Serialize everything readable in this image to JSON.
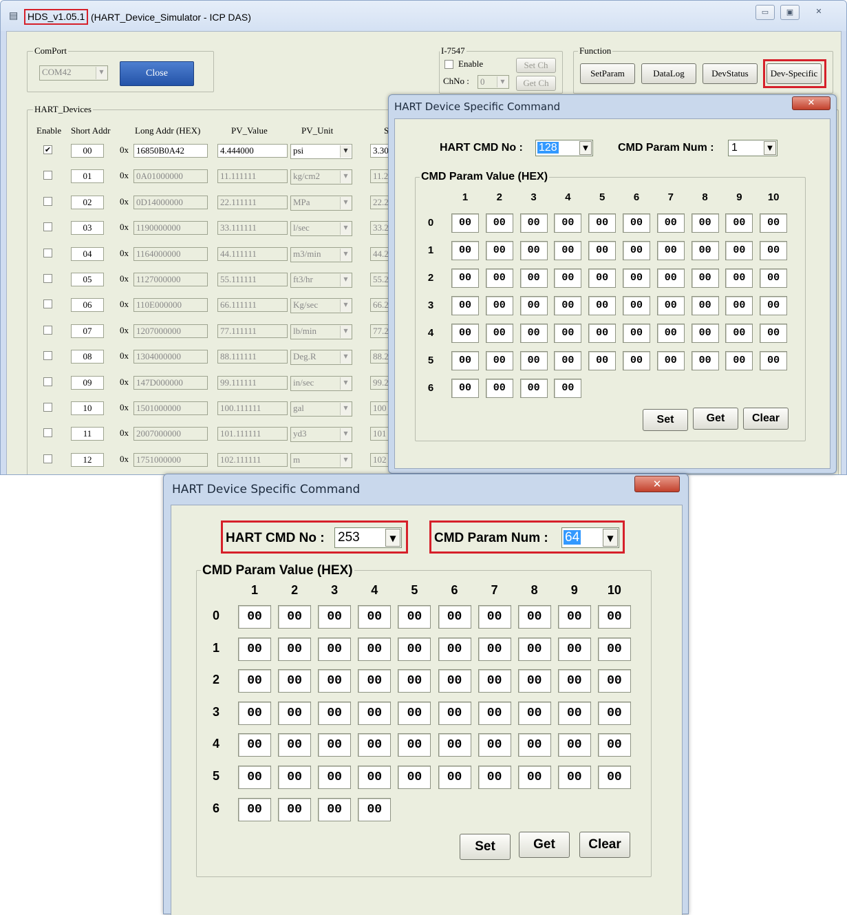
{
  "window": {
    "title_version": "HDS_v1.05.1",
    "title_rest": "(HART_Device_Simulator - ICP DAS)",
    "minimize": "▭",
    "maximize": "▣",
    "close": "✕"
  },
  "comport": {
    "legend": "ComPort",
    "value": "COM42",
    "close_button": "Close"
  },
  "i7547": {
    "legend": "I-7547",
    "enable_label": "Enable",
    "set_ch": "Set Ch",
    "get_ch": "Get Ch",
    "chno_label": "ChNo :",
    "chno_value": "0"
  },
  "function": {
    "legend": "Function",
    "buttons": [
      "SetParam",
      "DataLog",
      "DevStatus",
      "Dev-Specific"
    ]
  },
  "hart_devices": {
    "legend": "HART_Devices",
    "headers": [
      "Enable",
      "Short Addr",
      "Long Addr (HEX)",
      "PV_Value",
      "PV_Unit",
      "S"
    ],
    "hex_prefix": "0x",
    "rows": [
      {
        "enabled": true,
        "short": "00",
        "long": "16850B0A42",
        "pv": "4.444000",
        "unit": "psi",
        "sv": "3.30"
      },
      {
        "enabled": false,
        "short": "01",
        "long": "0A01000000",
        "pv": "11.111111",
        "unit": "kg/cm2",
        "sv": "11.2"
      },
      {
        "enabled": false,
        "short": "02",
        "long": "0D14000000",
        "pv": "22.111111",
        "unit": "MPa",
        "sv": "22.2"
      },
      {
        "enabled": false,
        "short": "03",
        "long": "1190000000",
        "pv": "33.111111",
        "unit": "l/sec",
        "sv": "33.2"
      },
      {
        "enabled": false,
        "short": "04",
        "long": "1164000000",
        "pv": "44.111111",
        "unit": "m3/min",
        "sv": "44.2"
      },
      {
        "enabled": false,
        "short": "05",
        "long": "1127000000",
        "pv": "55.111111",
        "unit": "ft3/hr",
        "sv": "55.2"
      },
      {
        "enabled": false,
        "short": "06",
        "long": "110E000000",
        "pv": "66.111111",
        "unit": "Kg/sec",
        "sv": "66.2"
      },
      {
        "enabled": false,
        "short": "07",
        "long": "1207000000",
        "pv": "77.111111",
        "unit": "lb/min",
        "sv": "77.2"
      },
      {
        "enabled": false,
        "short": "08",
        "long": "1304000000",
        "pv": "88.111111",
        "unit": "Deg.R",
        "sv": "88.2"
      },
      {
        "enabled": false,
        "short": "09",
        "long": "147D000000",
        "pv": "99.111111",
        "unit": "in/sec",
        "sv": "99.2"
      },
      {
        "enabled": false,
        "short": "10",
        "long": "1501000000",
        "pv": "100.111111",
        "unit": "gal",
        "sv": "100"
      },
      {
        "enabled": false,
        "short": "11",
        "long": "2007000000",
        "pv": "101.111111",
        "unit": "yd3",
        "sv": "101"
      },
      {
        "enabled": false,
        "short": "12",
        "long": "1751000000",
        "pv": "102.111111",
        "unit": "m",
        "sv": "102"
      }
    ]
  },
  "dialog_small": {
    "title": "HART Device Specific Command",
    "close": "✕",
    "cmd_no_label": "HART CMD No :",
    "cmd_no_value": "128",
    "param_num_label": "CMD Param Num :",
    "param_num_value": "1",
    "group_label": "CMD Param Value (HEX)",
    "col_headers": [
      "1",
      "2",
      "3",
      "4",
      "5",
      "6",
      "7",
      "8",
      "9",
      "10"
    ],
    "row_headers": [
      "0",
      "1",
      "2",
      "3",
      "4",
      "5",
      "6"
    ],
    "cell_value": "00",
    "set": "Set",
    "get": "Get",
    "clear": "Clear"
  },
  "dialog_large": {
    "title": "HART Device Specific Command",
    "close": "✕",
    "cmd_no_label": "HART CMD No :",
    "cmd_no_value": "253",
    "param_num_label": "CMD Param Num :",
    "param_num_value": "64",
    "group_label": "CMD Param Value (HEX)",
    "col_headers": [
      "1",
      "2",
      "3",
      "4",
      "5",
      "6",
      "7",
      "8",
      "9",
      "10"
    ],
    "row_headers": [
      "0",
      "1",
      "2",
      "3",
      "4",
      "5",
      "6"
    ],
    "cell_value": "00",
    "set": "Set",
    "get": "Get",
    "clear": "Clear"
  },
  "colors": {
    "highlight_red": "#d6202a",
    "close_button_blue": "#2f5fb0",
    "selection_blue": "#3399ff"
  }
}
